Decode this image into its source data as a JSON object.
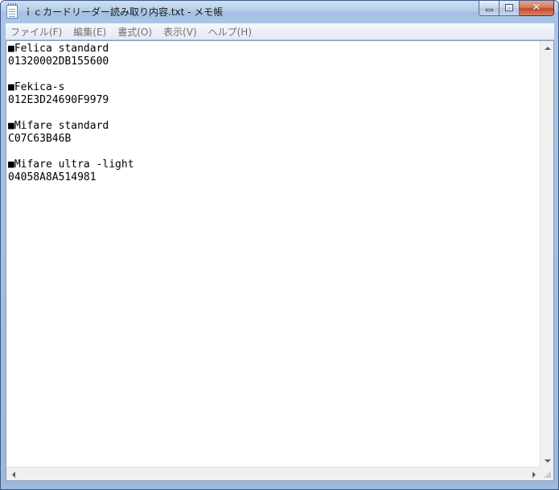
{
  "window": {
    "title": "ｉｃカードリーダー読み取り内容.txt - メモ帳",
    "icon": "notepad-icon"
  },
  "caption_buttons": {
    "minimize_icon": "minimize-icon",
    "maximize_icon": "maximize-icon",
    "close_icon": "close-icon",
    "close_glyph": "✕"
  },
  "menu": {
    "items": [
      {
        "label": "ファイル(F)"
      },
      {
        "label": "編集(E)"
      },
      {
        "label": "書式(O)"
      },
      {
        "label": "表示(V)"
      },
      {
        "label": "ヘルプ(H)"
      }
    ]
  },
  "document": {
    "lines": [
      "■Felica standard",
      "01320002DB155600",
      "",
      "■Fekica-s",
      "012E3D24690F9979",
      "",
      "■Mifare standard",
      "C07C63B46B",
      "",
      "■Mifare ultra -light",
      "04058A8A514981"
    ]
  },
  "colors": {
    "title_bar": "#a9c4e4",
    "close_button": "#c24a2c",
    "menu_text": "#6f6f6f",
    "editor_background": "#ffffff"
  }
}
